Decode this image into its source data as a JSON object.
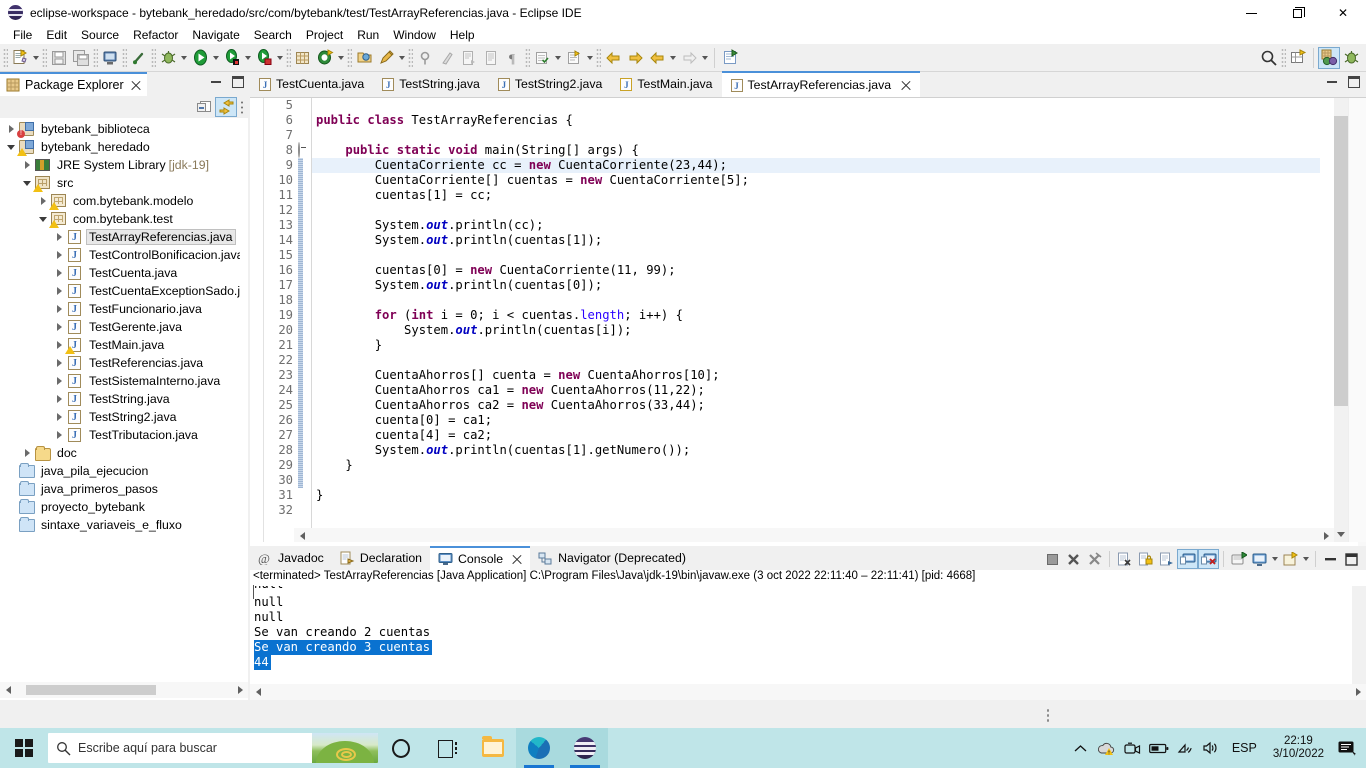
{
  "window": {
    "title": "eclipse-workspace - bytebank_heredado/src/com/bytebank/test/TestArrayReferencias.java - Eclipse IDE",
    "icon": "eclipse-icon",
    "minimize_label": "Minimize",
    "maximize_label": "Restore",
    "close_label": "Close"
  },
  "menubar": {
    "items": [
      "File",
      "Edit",
      "Source",
      "Refactor",
      "Navigate",
      "Search",
      "Project",
      "Run",
      "Window",
      "Help"
    ]
  },
  "toolbar": {
    "buttons": [
      {
        "name": "new-wizard-icon",
        "dropdown": true
      },
      {
        "name": "save-icon",
        "dropdown": false
      },
      {
        "name": "save-all-icon",
        "dropdown": false
      },
      {
        "name": "print-icon",
        "dropdown": false
      },
      {
        "name": "quick-access-icon",
        "dropdown": false
      },
      {
        "name": "debug-icon",
        "dropdown": true
      },
      {
        "name": "run-icon",
        "dropdown": true
      },
      {
        "name": "run-coverage-icon",
        "dropdown": true
      },
      {
        "name": "external-tools-icon",
        "dropdown": true
      },
      {
        "name": "new-java-package-icon",
        "dropdown": false
      },
      {
        "name": "new-java-class-icon",
        "dropdown": true
      },
      {
        "name": "open-type-icon",
        "dropdown": false
      },
      {
        "name": "search-tool-icon",
        "dropdown": true
      },
      {
        "name": "last-edit-icon",
        "dropdown": false
      },
      {
        "name": "skip-breakpoints-icon",
        "dropdown": false
      },
      {
        "name": "next-annotation-icon",
        "dropdown": false
      },
      {
        "name": "previous-annotation-icon",
        "dropdown": false
      },
      {
        "name": "toggle-mark-occurrences-icon",
        "dropdown": false
      },
      {
        "name": "toggle-block-selection-icon",
        "dropdown": true
      },
      {
        "name": "toggle-whitespace-icon",
        "dropdown": true
      },
      {
        "name": "back-icon",
        "dropdown": false
      },
      {
        "name": "forward-icon",
        "dropdown": false
      },
      {
        "name": "previous-edit-icon",
        "dropdown": true
      },
      {
        "name": "next-edit-icon",
        "dropdown": true
      },
      {
        "name": "open-task-icon",
        "dropdown": false
      }
    ],
    "right_buttons": [
      {
        "name": "search-magnifier-icon"
      },
      {
        "name": "new-perspective-icon"
      },
      {
        "name": "perspective-java-icon",
        "active": true
      },
      {
        "name": "perspective-debug-icon",
        "active": false
      }
    ]
  },
  "package_explorer": {
    "title": "Package Explorer",
    "close_label": "×",
    "toolbar": [
      {
        "name": "collapse-all-icon",
        "active": false
      },
      {
        "name": "link-with-editor-icon",
        "active": true
      },
      {
        "name": "view-menu-icon",
        "active": false
      }
    ],
    "tree": [
      {
        "indent": 0,
        "twisty": "right",
        "icon": "project-error",
        "label": "bytebank_biblioteca",
        "selected": false
      },
      {
        "indent": 0,
        "twisty": "down",
        "icon": "project-warn",
        "label": "bytebank_heredado",
        "selected": false
      },
      {
        "indent": 1,
        "twisty": "right",
        "icon": "library",
        "label": "JRE System Library",
        "suffix": "[jdk-19]",
        "selected": false
      },
      {
        "indent": 1,
        "twisty": "down",
        "icon": "source-folder",
        "label": "src",
        "selected": false
      },
      {
        "indent": 2,
        "twisty": "right",
        "icon": "package-warn",
        "label": "com.bytebank.modelo",
        "selected": false
      },
      {
        "indent": 2,
        "twisty": "down",
        "icon": "package-warn",
        "label": "com.bytebank.test",
        "selected": false
      },
      {
        "indent": 3,
        "twisty": "right",
        "icon": "java-file",
        "label": "TestArrayReferencias.java",
        "selected": true
      },
      {
        "indent": 3,
        "twisty": "right",
        "icon": "java-file",
        "label": "TestControlBonificacion.java",
        "selected": false
      },
      {
        "indent": 3,
        "twisty": "right",
        "icon": "java-file",
        "label": "TestCuenta.java",
        "selected": false
      },
      {
        "indent": 3,
        "twisty": "right",
        "icon": "java-file",
        "label": "TestCuentaExceptionSado.java",
        "selected": false
      },
      {
        "indent": 3,
        "twisty": "right",
        "icon": "java-file",
        "label": "TestFuncionario.java",
        "selected": false
      },
      {
        "indent": 3,
        "twisty": "right",
        "icon": "java-file",
        "label": "TestGerente.java",
        "selected": false
      },
      {
        "indent": 3,
        "twisty": "right",
        "icon": "java-file-warn",
        "label": "TestMain.java",
        "selected": false
      },
      {
        "indent": 3,
        "twisty": "right",
        "icon": "java-file",
        "label": "TestReferencias.java",
        "selected": false
      },
      {
        "indent": 3,
        "twisty": "right",
        "icon": "java-file",
        "label": "TestSistemaInterno.java",
        "selected": false
      },
      {
        "indent": 3,
        "twisty": "right",
        "icon": "java-file",
        "label": "TestString.java",
        "selected": false
      },
      {
        "indent": 3,
        "twisty": "right",
        "icon": "java-file",
        "label": "TestString2.java",
        "selected": false
      },
      {
        "indent": 3,
        "twisty": "right",
        "icon": "java-file",
        "label": "TestTributacion.java",
        "selected": false
      },
      {
        "indent": 1,
        "twisty": "right",
        "icon": "folder",
        "label": "doc",
        "selected": false
      },
      {
        "indent": 0,
        "twisty": "none",
        "icon": "closed-project",
        "label": "java_pila_ejecucion",
        "selected": false
      },
      {
        "indent": 0,
        "twisty": "none",
        "icon": "closed-project",
        "label": "java_primeros_pasos",
        "selected": false
      },
      {
        "indent": 0,
        "twisty": "none",
        "icon": "closed-project",
        "label": "proyecto_bytebank",
        "selected": false
      },
      {
        "indent": 0,
        "twisty": "none",
        "icon": "closed-project",
        "label": "sintaxe_variaveis_e_fluxo",
        "selected": false
      }
    ]
  },
  "editor": {
    "tabs": [
      {
        "label": "TestCuenta.java",
        "active": false,
        "icon": "java-file"
      },
      {
        "label": "TestString.java",
        "active": false,
        "icon": "java-file"
      },
      {
        "label": "TestString2.java",
        "active": false,
        "icon": "java-file"
      },
      {
        "label": "TestMain.java",
        "active": false,
        "icon": "java-file-warn"
      },
      {
        "label": "TestArrayReferencias.java",
        "active": true,
        "icon": "java-file"
      }
    ],
    "close_label": "×",
    "first_visible_line": 5,
    "current_line": 9,
    "code": [
      {
        "n": 5,
        "segments": [],
        "fold": false
      },
      {
        "n": 6,
        "segments": [
          {
            "t": "public",
            "c": "kw"
          },
          {
            "t": " ",
            "c": ""
          },
          {
            "t": "class",
            "c": "kw"
          },
          {
            "t": " TestArrayReferencias {",
            "c": ""
          }
        ],
        "fold": false
      },
      {
        "n": 7,
        "segments": [],
        "fold": false
      },
      {
        "n": 8,
        "segments": [
          {
            "t": "    ",
            "c": ""
          },
          {
            "t": "public",
            "c": "kw"
          },
          {
            "t": " ",
            "c": ""
          },
          {
            "t": "static",
            "c": "kw"
          },
          {
            "t": " ",
            "c": ""
          },
          {
            "t": "void",
            "c": "kw"
          },
          {
            "t": " main(String[] args) {",
            "c": ""
          }
        ],
        "fold": true
      },
      {
        "n": 9,
        "segments": [
          {
            "t": "        CuentaCorriente cc = ",
            "c": ""
          },
          {
            "t": "new",
            "c": "kw"
          },
          {
            "t": " CuentaCorriente(23,44);",
            "c": ""
          }
        ],
        "fold": false
      },
      {
        "n": 10,
        "segments": [
          {
            "t": "        CuentaCorriente[] cuentas = ",
            "c": ""
          },
          {
            "t": "new",
            "c": "kw"
          },
          {
            "t": " CuentaCorriente[5];",
            "c": ""
          }
        ],
        "fold": false
      },
      {
        "n": 11,
        "segments": [
          {
            "t": "        cuentas[1] = cc;",
            "c": ""
          }
        ],
        "fold": false
      },
      {
        "n": 12,
        "segments": [],
        "fold": false
      },
      {
        "n": 13,
        "segments": [
          {
            "t": "        System.",
            "c": ""
          },
          {
            "t": "out",
            "c": "fld"
          },
          {
            "t": ".println(cc);",
            "c": ""
          }
        ],
        "fold": false
      },
      {
        "n": 14,
        "segments": [
          {
            "t": "        System.",
            "c": ""
          },
          {
            "t": "out",
            "c": "fld"
          },
          {
            "t": ".println(cuentas[1]);",
            "c": ""
          }
        ],
        "fold": false
      },
      {
        "n": 15,
        "segments": [],
        "fold": false
      },
      {
        "n": 16,
        "segments": [
          {
            "t": "        cuentas[0] = ",
            "c": ""
          },
          {
            "t": "new",
            "c": "kw"
          },
          {
            "t": " CuentaCorriente(11, 99);",
            "c": ""
          }
        ],
        "fold": false
      },
      {
        "n": 17,
        "segments": [
          {
            "t": "        System.",
            "c": ""
          },
          {
            "t": "out",
            "c": "fld"
          },
          {
            "t": ".println(cuentas[0]);",
            "c": ""
          }
        ],
        "fold": false
      },
      {
        "n": 18,
        "segments": [],
        "fold": false
      },
      {
        "n": 19,
        "segments": [
          {
            "t": "        ",
            "c": ""
          },
          {
            "t": "for",
            "c": "kw"
          },
          {
            "t": " (",
            "c": ""
          },
          {
            "t": "int",
            "c": "kw"
          },
          {
            "t": " i = ",
            "c": ""
          },
          {
            "t": "0",
            "c": ""
          },
          {
            "t": "; i < cuentas.",
            "c": ""
          },
          {
            "t": "length",
            "c": "st"
          },
          {
            "t": "; i++) {",
            "c": ""
          }
        ],
        "fold": false
      },
      {
        "n": 20,
        "segments": [
          {
            "t": "            System.",
            "c": ""
          },
          {
            "t": "out",
            "c": "fld"
          },
          {
            "t": ".println(cuentas[i]);",
            "c": ""
          }
        ],
        "fold": false
      },
      {
        "n": 21,
        "segments": [
          {
            "t": "        }",
            "c": ""
          }
        ],
        "fold": false
      },
      {
        "n": 22,
        "segments": [],
        "fold": false
      },
      {
        "n": 23,
        "segments": [
          {
            "t": "        CuentaAhorros[] cuenta = ",
            "c": ""
          },
          {
            "t": "new",
            "c": "kw"
          },
          {
            "t": " CuentaAhorros[10];",
            "c": ""
          }
        ],
        "fold": false
      },
      {
        "n": 24,
        "segments": [
          {
            "t": "        CuentaAhorros ca1 = ",
            "c": ""
          },
          {
            "t": "new",
            "c": "kw"
          },
          {
            "t": " CuentaAhorros(11,22);",
            "c": ""
          }
        ],
        "fold": false
      },
      {
        "n": 25,
        "segments": [
          {
            "t": "        CuentaAhorros ca2 = ",
            "c": ""
          },
          {
            "t": "new",
            "c": "kw"
          },
          {
            "t": " CuentaAhorros(33,44);",
            "c": ""
          }
        ],
        "fold": false
      },
      {
        "n": 26,
        "segments": [
          {
            "t": "        cuenta[0] = ca1;",
            "c": ""
          }
        ],
        "fold": false
      },
      {
        "n": 27,
        "segments": [
          {
            "t": "        cuenta[4] = ca2;",
            "c": ""
          }
        ],
        "fold": false
      },
      {
        "n": 28,
        "segments": [
          {
            "t": "        System.",
            "c": ""
          },
          {
            "t": "out",
            "c": "fld"
          },
          {
            "t": ".println(cuentas[1].getNumero());",
            "c": ""
          }
        ],
        "fold": false
      },
      {
        "n": 29,
        "segments": [
          {
            "t": "    }",
            "c": ""
          }
        ],
        "fold": false
      },
      {
        "n": 30,
        "segments": [],
        "fold": false
      },
      {
        "n": 31,
        "segments": [
          {
            "t": "}",
            "c": ""
          }
        ],
        "fold": false
      },
      {
        "n": 32,
        "segments": [],
        "fold": false
      }
    ]
  },
  "console_panel": {
    "tabs": [
      {
        "label": "Javadoc",
        "icon": "javadoc-icon",
        "active": false
      },
      {
        "label": "Declaration",
        "icon": "declaration-icon",
        "active": false
      },
      {
        "label": "Console",
        "icon": "console-icon",
        "active": true
      },
      {
        "label": "Navigator (Deprecated)",
        "icon": "navigator-icon",
        "active": false
      }
    ],
    "close_label": "×",
    "header": "<terminated> TestArrayReferencias [Java Application] C:\\Program Files\\Java\\jdk-19\\bin\\javaw.exe  (3 oct 2022 22:11:40 – 22:11:41) [pid: 4668]",
    "output": [
      {
        "text": "null",
        "selected": false,
        "clipped": true
      },
      {
        "text": "null",
        "selected": false
      },
      {
        "text": "null",
        "selected": false
      },
      {
        "text": "Se van creando 2 cuentas",
        "selected": false
      },
      {
        "text": "Se van creando 3 cuentas",
        "selected": true
      },
      {
        "text": "44",
        "selected": true
      }
    ],
    "tools": [
      {
        "name": "terminate-icon",
        "active": false
      },
      {
        "name": "remove-launch-icon",
        "active": false
      },
      {
        "name": "remove-all-terminated-icon",
        "active": false
      },
      {
        "name": "clear-console-icon",
        "active": false
      },
      {
        "name": "scroll-lock-icon",
        "active": false
      },
      {
        "name": "word-wrap-icon",
        "active": false
      },
      {
        "name": "show-console-on-output-icon",
        "active": true
      },
      {
        "name": "show-console-on-error-icon",
        "active": true
      },
      {
        "name": "pin-console-icon",
        "active": false
      },
      {
        "name": "display-selected-console-icon",
        "active": false,
        "dropdown": true
      },
      {
        "name": "open-console-icon",
        "active": false,
        "dropdown": true
      },
      {
        "name": "minimize-panel-icon",
        "active": false
      },
      {
        "name": "maximize-panel-icon",
        "active": false
      }
    ]
  },
  "taskbar": {
    "start_label": "Start",
    "search_placeholder": "Escribe aquí para buscar",
    "search_icon": "search-icon",
    "items": [
      {
        "name": "cortana-icon",
        "running": false
      },
      {
        "name": "task-view-icon",
        "running": false
      },
      {
        "name": "file-explorer-icon",
        "running": false
      },
      {
        "name": "microsoft-edge-icon",
        "running": true
      },
      {
        "name": "eclipse-icon",
        "running": true
      }
    ],
    "tray": [
      {
        "name": "show-hidden-icons-icon"
      },
      {
        "name": "onedrive-warning-icon"
      },
      {
        "name": "meet-now-icon"
      },
      {
        "name": "battery-icon"
      },
      {
        "name": "wifi-icon"
      },
      {
        "name": "volume-icon"
      }
    ],
    "language": "ESP",
    "time": "22:19",
    "date": "3/10/2022",
    "notification_icon": "action-center-icon"
  },
  "colors": {
    "accent": "#4a90d9",
    "selection": "#0a72d0",
    "current_line": "#e8f1fb",
    "keyword": "#7f0055",
    "field": "#0000c0",
    "taskbar": "#bfe5e8"
  }
}
